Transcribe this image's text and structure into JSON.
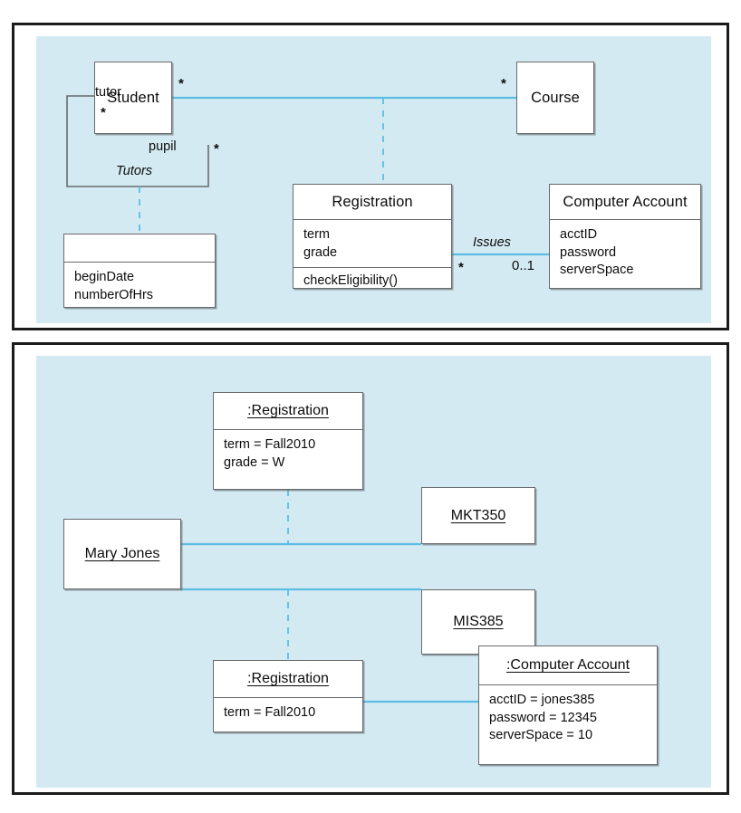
{
  "figure": {
    "background": "#ffffff",
    "panel_border_color": "#1b1b1b",
    "canvas_color": "#d4eaf2",
    "link_color": "#5bbde4",
    "box_border_color": "#666a6d"
  },
  "class_diagram": {
    "name": "class-diagram-panel",
    "classes": [
      {
        "id": "student",
        "name": "Student",
        "attributes": [],
        "operations": []
      },
      {
        "id": "course",
        "name": "Course",
        "attributes": [],
        "operations": []
      },
      {
        "id": "registration",
        "name": "Registration",
        "attributes": [
          "term",
          "grade"
        ],
        "operations": [
          "checkEligibility()"
        ]
      },
      {
        "id": "computer-account",
        "name": "Computer Account",
        "attributes": [
          "acctID",
          "password",
          "serverSpace"
        ],
        "operations": []
      },
      {
        "id": "tutors-association-class",
        "name": "",
        "attributes": [
          "beginDate",
          "numberOfHrs"
        ],
        "operations": []
      }
    ],
    "associations": [
      {
        "id": "tutors",
        "label": "Tutors",
        "role_source": "tutor",
        "role_target": "pupil",
        "multiplicity_source": "*",
        "multiplicity_target": "*"
      },
      {
        "id": "student-course",
        "label": "",
        "multiplicity_source": "*",
        "multiplicity_target": "*"
      },
      {
        "id": "issues",
        "label": "Issues",
        "multiplicity_source": "*",
        "multiplicity_target": "0..1"
      }
    ]
  },
  "object_diagram": {
    "name": "object-diagram-panel",
    "objects": [
      {
        "id": "mary-jones",
        "name": "Mary Jones",
        "slots": []
      },
      {
        "id": "registration-1",
        "name": ":Registration",
        "slots": [
          "term = Fall2010",
          "grade = W"
        ]
      },
      {
        "id": "mkt350",
        "name": "MKT350",
        "slots": []
      },
      {
        "id": "mis385",
        "name": "MIS385",
        "slots": []
      },
      {
        "id": "registration-2",
        "name": ":Registration",
        "slots": [
          "term = Fall2010"
        ]
      },
      {
        "id": "computer-account-obj",
        "name": ":Computer Account",
        "slots": [
          "acctID = jones385",
          "password = 12345",
          "serverSpace = 10"
        ]
      }
    ]
  }
}
